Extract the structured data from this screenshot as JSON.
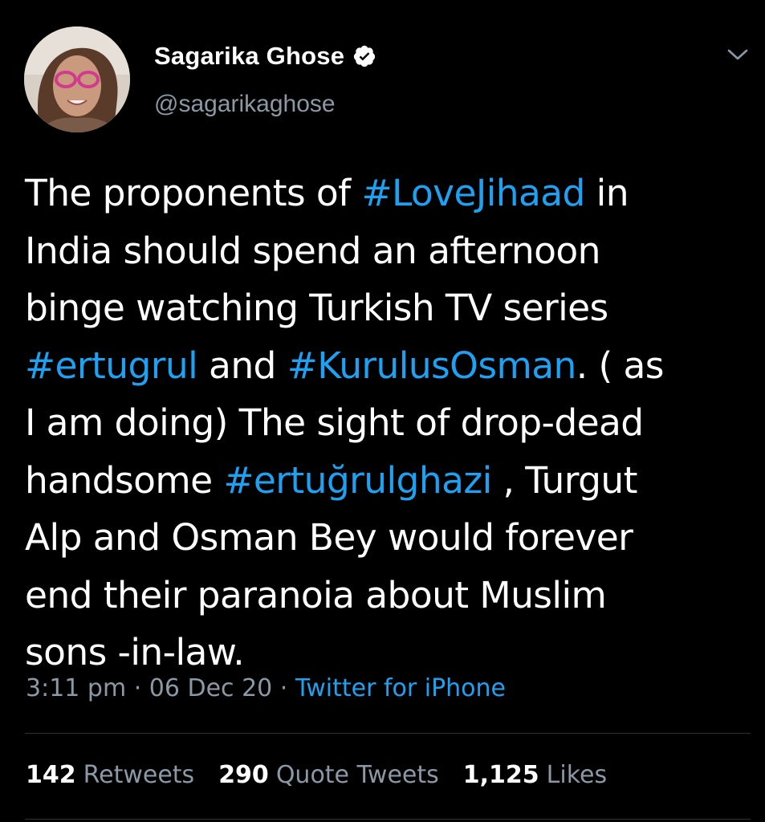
{
  "author": {
    "display_name": "Sagarika Ghose",
    "handle": "@sagarikaghose",
    "verified": true
  },
  "tweet": {
    "lines": [
      [
        {
          "t": "The proponents of ",
          "tag": false
        },
        {
          "t": "#LoveJihaad",
          "tag": true
        },
        {
          "t": " in",
          "tag": false
        }
      ],
      [
        {
          "t": "India should spend an afternoon",
          "tag": false
        }
      ],
      [
        {
          "t": "binge watching Turkish TV series",
          "tag": false
        }
      ],
      [
        {
          "t": "#ertugrul",
          "tag": true
        },
        {
          "t": " and ",
          "tag": false
        },
        {
          "t": "#KurulusOsman",
          "tag": true
        },
        {
          "t": ". ( as",
          "tag": false
        }
      ],
      [
        {
          "t": "I am doing) The sight of drop-dead",
          "tag": false
        }
      ],
      [
        {
          "t": "handsome ",
          "tag": false
        },
        {
          "t": "#ertuğrulghazi",
          "tag": true
        },
        {
          "t": " , Turgut",
          "tag": false
        }
      ],
      [
        {
          "t": "Alp and Osman Bey would forever",
          "tag": false
        }
      ],
      [
        {
          "t": "end their paranoia about Muslim",
          "tag": false
        }
      ],
      [
        {
          "t": "sons -in-law.",
          "tag": false
        }
      ]
    ]
  },
  "meta": {
    "time": "3:11 pm",
    "separator": " · ",
    "date": "06 Dec 20",
    "source": "Twitter for iPhone"
  },
  "stats": {
    "retweets": {
      "count": "142",
      "label": "Retweets"
    },
    "quote_tweets": {
      "count": "290",
      "label": "Quote Tweets"
    },
    "likes": {
      "count": "1,125",
      "label": "Likes"
    }
  },
  "colors": {
    "background": "#000000",
    "text": "#ffffff",
    "secondary": "#8b98a5",
    "accent": "#1da1f2",
    "divider": "#2f3336"
  },
  "icons": {
    "verified": "verified-badge-icon",
    "menu": "chevron-down-icon"
  }
}
